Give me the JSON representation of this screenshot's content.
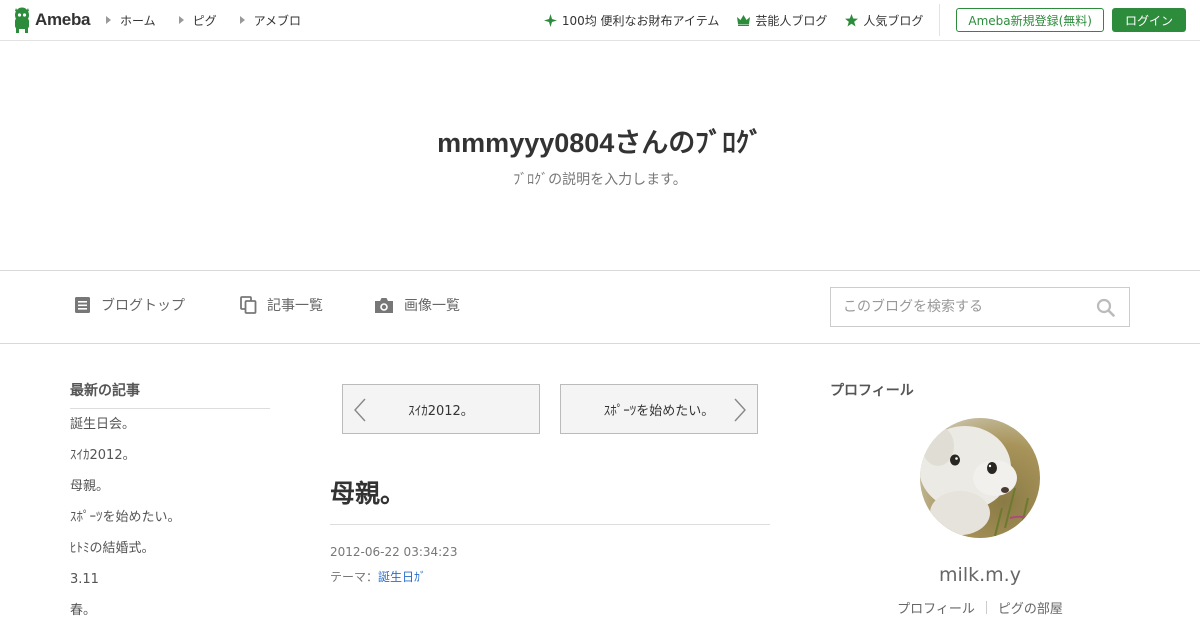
{
  "header": {
    "logo_text": "Ameba",
    "nav": [
      "ホーム",
      "ピグ",
      "アメブロ"
    ],
    "links": [
      {
        "label": "100均 便利なお財布アイテム",
        "icon": "sparkle-icon"
      },
      {
        "label": "芸能人ブログ",
        "icon": "crown-icon"
      },
      {
        "label": "人気ブログ",
        "icon": "star-icon"
      }
    ],
    "register_label": "Ameba新規登録(無料)",
    "login_label": "ログイン",
    "accent_color": "#2d8c3c"
  },
  "blog": {
    "title": "mmmyyy0804さんのﾌﾞﾛｸﾞ",
    "description": "ﾌﾞﾛｸﾞの説明を入力します。"
  },
  "navbar": {
    "items": [
      {
        "label": "ブログトップ",
        "icon": "document-icon"
      },
      {
        "label": "記事一覧",
        "icon": "copy-icon"
      },
      {
        "label": "画像一覧",
        "icon": "camera-icon"
      }
    ],
    "search_placeholder": "このブログを検索する"
  },
  "sidebar": {
    "heading": "最新の記事",
    "items": [
      "誕生日会。",
      "ｽｲｶ2012。",
      "母親。",
      "ｽﾎﾟｰﾂを始めたい。",
      "ﾋﾄﾐの結婚式。",
      "3.11",
      "春。"
    ]
  },
  "entry": {
    "prev_label": "ｽｲｶ2012。",
    "next_label": "ｽﾎﾟｰﾂを始めたい。",
    "title": "母親。",
    "date": "2012-06-22 03:34:23",
    "theme_label": "テーマ：",
    "theme_value": "誕生日ｶﾞ"
  },
  "profile": {
    "heading": "プロフィール",
    "name": "milk.m.y",
    "links": [
      "プロフィール",
      "ピグの部屋"
    ]
  }
}
